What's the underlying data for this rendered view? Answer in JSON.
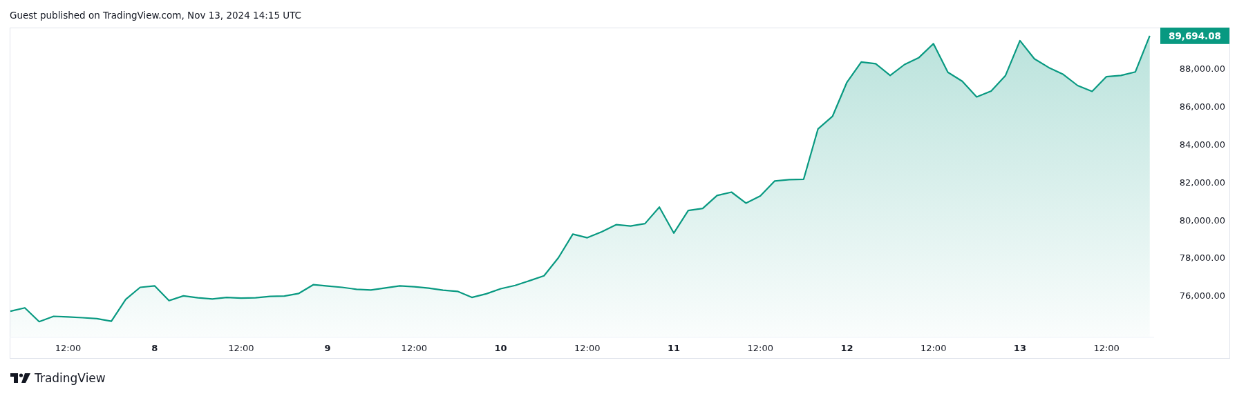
{
  "header": {
    "text": "Guest published on TradingView.com, Nov 13, 2024 14:15 UTC"
  },
  "chart": {
    "last_price": "89,694.08",
    "chart_data": {
      "type": "area",
      "categories": [
        null,
        null,
        null,
        null,
        "12:00",
        null,
        null,
        null,
        null,
        null,
        "8",
        null,
        null,
        null,
        null,
        null,
        "12:00",
        null,
        null,
        null,
        null,
        null,
        "9",
        null,
        null,
        null,
        null,
        null,
        "12:00",
        null,
        null,
        null,
        null,
        null,
        "10",
        null,
        null,
        null,
        null,
        null,
        "12:00",
        null,
        null,
        null,
        null,
        null,
        "11",
        null,
        null,
        null,
        null,
        null,
        "12:00",
        null,
        null,
        null,
        null,
        null,
        "12",
        null,
        null,
        null,
        null,
        null,
        "12:00",
        null,
        null,
        null,
        null,
        null,
        "13",
        null,
        null,
        null,
        null,
        null,
        "12:00",
        null,
        null,
        null
      ],
      "series": [
        {
          "color": "#089981",
          "values": [
            75170,
            75350,
            74620,
            74900,
            74870,
            74830,
            74780,
            74640,
            75800,
            76430,
            76510,
            75730,
            75980,
            75880,
            75820,
            75900,
            75860,
            75880,
            75950,
            75970,
            76110,
            76570,
            76500,
            76430,
            76330,
            76290,
            76400,
            76510,
            76460,
            76390,
            76280,
            76220,
            75900,
            76090,
            76360,
            76530,
            76780,
            77040,
            78000,
            79240,
            79050,
            79370,
            79740,
            79670,
            79800,
            80670,
            79300,
            80490,
            80600,
            81280,
            81460,
            80880,
            81260,
            82050,
            82120,
            82140,
            84800,
            85460,
            87260,
            88330,
            88240,
            87620,
            88200,
            88570,
            89300,
            87790,
            87320,
            86490,
            86800,
            87620,
            89460,
            88500,
            88040,
            87680,
            87090,
            86780,
            87560,
            87620,
            87810,
            89720
          ]
        }
      ],
      "ylim": [
        73790,
        90150
      ],
      "yticks": [
        {
          "value": 76000,
          "label": "76,000.00"
        },
        {
          "value": 78000,
          "label": "78,000.00"
        },
        {
          "value": 80000,
          "label": "80,000.00"
        },
        {
          "value": 82000,
          "label": "82,000.00"
        },
        {
          "value": 84000,
          "label": "84,000.00"
        },
        {
          "value": 86000,
          "label": "86,000.00"
        },
        {
          "value": 88000,
          "label": "88,000.00"
        }
      ]
    }
  },
  "footer": {
    "logo_text": "TradingView"
  }
}
